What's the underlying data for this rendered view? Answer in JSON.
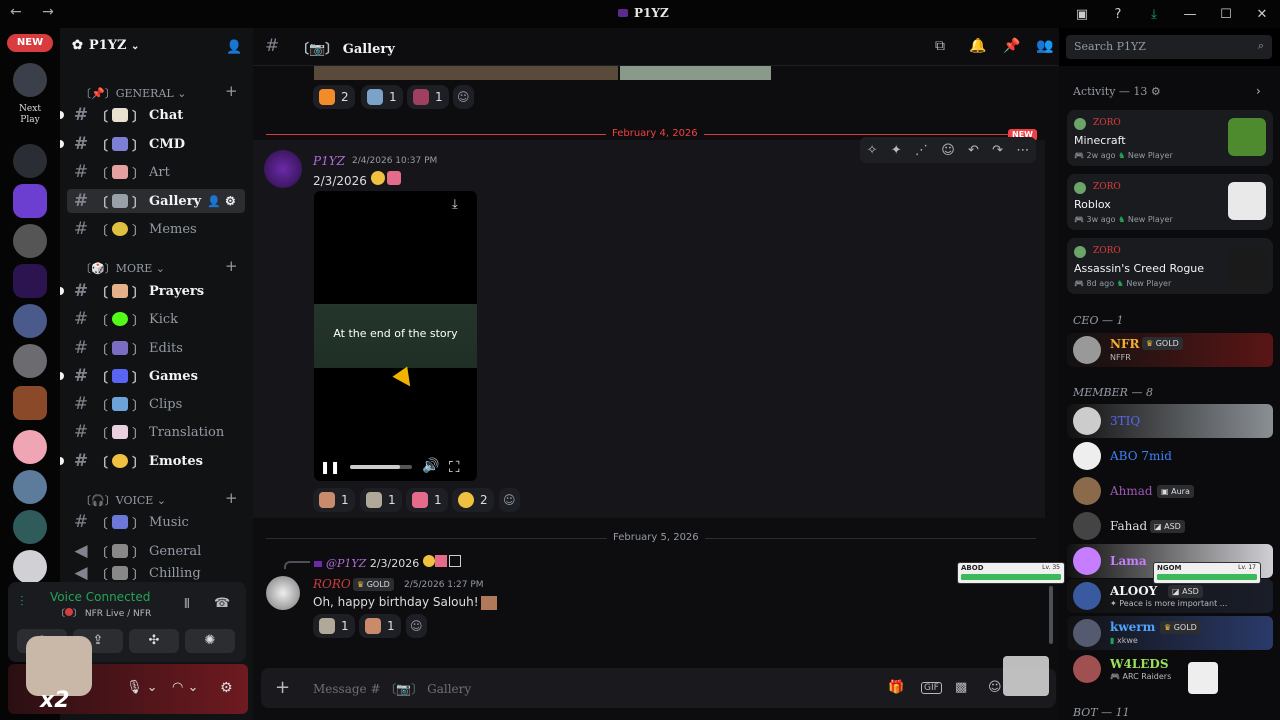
{
  "window": {
    "title": "P1YZ"
  },
  "rail": {
    "new_badge": "NEW",
    "next_play": "Next Play"
  },
  "server": {
    "name": "P1YZ"
  },
  "sidebar": {
    "categories": [
      {
        "label": "GENERAL"
      },
      {
        "label": "MORE"
      },
      {
        "label": "VOICE"
      }
    ],
    "channels": [
      {
        "label": "Chat"
      },
      {
        "label": "CMD"
      },
      {
        "label": "Art"
      },
      {
        "label": "Gallery"
      },
      {
        "label": "Memes"
      },
      {
        "label": "Prayers"
      },
      {
        "label": "Kick"
      },
      {
        "label": "Edits"
      },
      {
        "label": "Games"
      },
      {
        "label": "Clips"
      },
      {
        "label": "Translation"
      },
      {
        "label": "Emotes"
      },
      {
        "label": "Music"
      },
      {
        "label": "General"
      },
      {
        "label": "Chilling"
      }
    ]
  },
  "voice": {
    "status": "Voice Connected",
    "location": "NFR Live / NFR"
  },
  "user": {
    "overlay": "x2"
  },
  "header": {
    "channel": "Gallery",
    "search_placeholder": "Search P1YZ"
  },
  "messages": {
    "top_reactions": [
      {
        "count": "2",
        "emoji": "fire-emoji"
      },
      {
        "count": "1",
        "emoji": "person-emoji"
      },
      {
        "count": "1",
        "emoji": "image-emoji"
      }
    ],
    "day1": {
      "label": "February 4, 2026",
      "new": "NEW"
    },
    "msg1": {
      "author": "P1YZ",
      "time": "2/4/2026 10:37 PM",
      "text": "2/3/2026",
      "video_caption": "At the end of the story",
      "reactions": [
        {
          "count": "1"
        },
        {
          "count": "1"
        },
        {
          "count": "1"
        },
        {
          "count": "2"
        }
      ]
    },
    "day2": {
      "label": "February 5, 2026"
    },
    "msg2": {
      "reply_author": "@P1YZ",
      "reply_text": "2/3/2026",
      "author": "RORO",
      "tag": "GOLD",
      "time": "2/5/2026 1:27 PM",
      "text": "Oh, happy birthday Salouh!",
      "reactions": [
        {
          "count": "1"
        },
        {
          "count": "1"
        }
      ]
    },
    "composer_placeholder": "Message #",
    "composer_channel": "Gallery"
  },
  "members": {
    "activity": {
      "label": "Activity — 13"
    },
    "activities": [
      {
        "user": "ZORO",
        "game": "Minecraft",
        "time": "2w ago",
        "status": "New Player",
        "art": "#4e8a2e"
      },
      {
        "user": "ZORO",
        "game": "Roblox",
        "time": "3w ago",
        "status": "New Player",
        "art": "#e9e9e9"
      },
      {
        "user": "ZORO",
        "game": "Assassin's Creed Rogue",
        "time": "8d ago",
        "status": "New Player",
        "art": "#1a1a1a"
      }
    ],
    "groups": [
      {
        "label": "CEO — 1"
      },
      {
        "label": "MEMBER — 8"
      },
      {
        "label": "BOT — 11"
      }
    ],
    "list": [
      {
        "name": "NFR",
        "tag": "GOLD",
        "sub": "NFFR",
        "color": "#f0b232"
      },
      {
        "name": "3TIQ",
        "tag": "",
        "sub": "",
        "color": "#5865f2"
      },
      {
        "name": "ABO 7mid",
        "tag": "",
        "sub": "",
        "color": "#3b82f6"
      },
      {
        "name": "Ahmad",
        "tag": "Aura",
        "sub": "",
        "color": "#9b59b6"
      },
      {
        "name": "Fahad",
        "tag": "ASD",
        "sub": "",
        "color": "#dbdee1"
      },
      {
        "name": "Lama",
        "tag": "",
        "sub": "",
        "color": "#c77dff"
      },
      {
        "name": "ALOOY",
        "tag": "ASD",
        "sub": "Peace is more important ...",
        "color": "#f2f3f5"
      },
      {
        "name": "kwerm",
        "tag": "GOLD",
        "sub": "xkwe",
        "color": "#4fa3ff"
      },
      {
        "name": "W4LEDS",
        "tag": "",
        "sub": "ARC Raiders",
        "color": "#9be15d"
      }
    ],
    "hp_cards": [
      {
        "name": "ABOD",
        "level": "Lv. 35"
      },
      {
        "name": "NGOM",
        "level": "Lv. 17"
      }
    ]
  },
  "colors": {
    "accent": "#5865f2",
    "danger": "#d83c3e",
    "online": "#23a559"
  }
}
